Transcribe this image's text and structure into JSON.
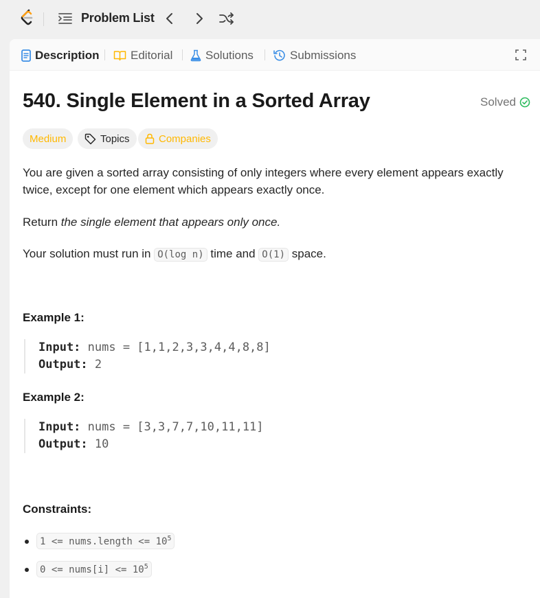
{
  "topbar": {
    "problem_list_label": "Problem List"
  },
  "tabs": {
    "description": "Description",
    "editorial": "Editorial",
    "solutions": "Solutions",
    "submissions": "Submissions"
  },
  "problem": {
    "title": "540. Single Element in a Sorted Array",
    "status": "Solved",
    "difficulty": "Medium",
    "topics_label": "Topics",
    "companies_label": "Companies",
    "desc_line1": "You are given a sorted array consisting of only integers where every element appears exactly",
    "desc_line2": "twice, except for one element which appears exactly once.",
    "return_prefix": "Return ",
    "return_em": "the single element that appears only once.",
    "complexity_prefix": "Your solution must run in ",
    "complexity_time": "O(log n)",
    "complexity_mid": " time and ",
    "complexity_space": "O(1)",
    "complexity_suffix": " space."
  },
  "examples": [
    {
      "heading": "Example 1:",
      "input_label": "Input:",
      "input_value": " nums = [1,1,2,3,3,4,4,8,8]",
      "output_label": "Output:",
      "output_value": " 2"
    },
    {
      "heading": "Example 2:",
      "input_label": "Input:",
      "input_value": " nums = [3,3,7,7,10,11,11]",
      "output_label": "Output:",
      "output_value": " 10"
    }
  ],
  "constraints": {
    "heading": "Constraints:",
    "items": [
      {
        "text": "1 <= nums.length <= 10",
        "sup": "5"
      },
      {
        "text": "0 <= nums[i] <= 10",
        "sup": "5"
      }
    ]
  },
  "colors": {
    "medium": "#ffb800",
    "solved_check": "#2cbb5d",
    "solutions_icon": "#3c8fe6"
  },
  "icons": [
    "leetcode-logo",
    "list-icon",
    "chevron-left-icon",
    "chevron-right-icon",
    "shuffle-icon",
    "description-icon",
    "book-icon",
    "flask-icon",
    "history-icon",
    "expand-icon",
    "check-circle-icon",
    "tag-icon",
    "lock-icon"
  ]
}
